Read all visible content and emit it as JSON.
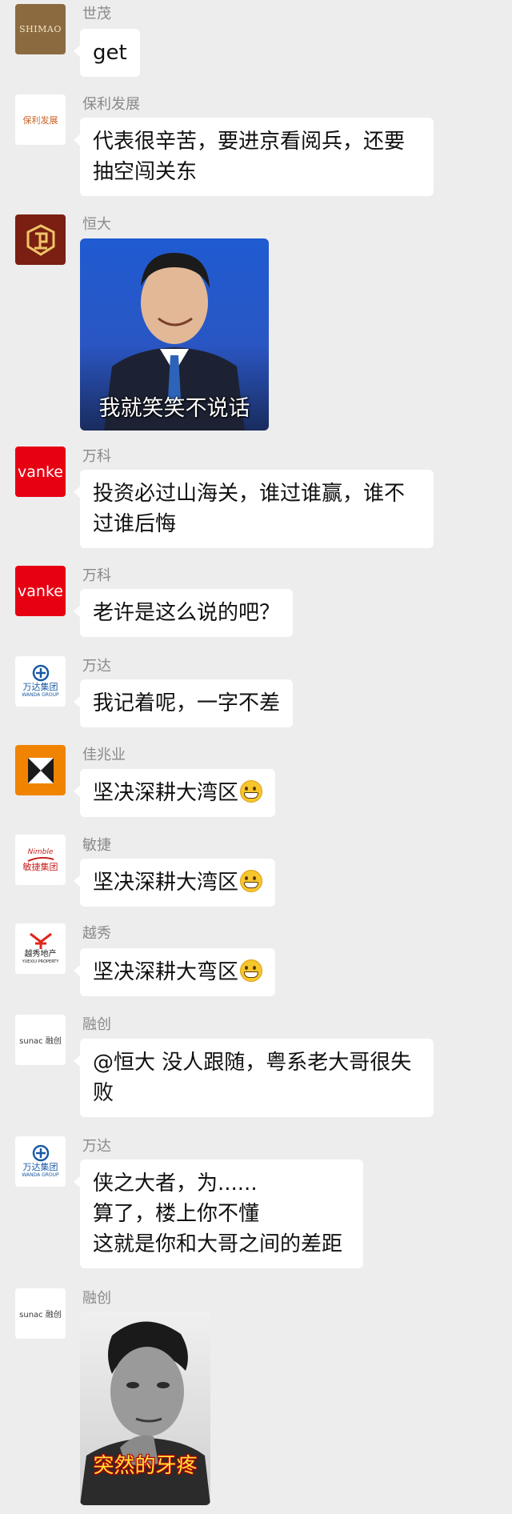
{
  "messages": [
    {
      "sender": "世茂",
      "logo_text": "SHIMAO",
      "text": "get"
    },
    {
      "sender": "保利发展",
      "logo_text": "保利发展",
      "text": "代表很辛苦，要进京看阅兵，还要\n抽空闯关东"
    },
    {
      "sender": "恒大",
      "image_caption": "我就笑笑不说话"
    },
    {
      "sender": "万科",
      "logo_text": "vanke",
      "text": "投资必过山海关，谁过谁赢，谁不\n过谁后悔"
    },
    {
      "sender": "万科",
      "logo_text": "vanke",
      "text": "老许是这么说的吧？"
    },
    {
      "sender": "万达",
      "logo_text": "万达集团",
      "logo_sub": "WANDA GROUP",
      "text": "我记着呢，一字不差"
    },
    {
      "sender": "佳兆业",
      "text": "坚决深耕大湾区"
    },
    {
      "sender": "敏捷",
      "logo_text": "敏捷集团",
      "logo_sub": "Nimble",
      "text": "坚决深耕大湾区"
    },
    {
      "sender": "越秀",
      "logo_text": "越秀地产",
      "logo_sub": "YUEXIU PROPERTY",
      "text": "坚决深耕大弯区"
    },
    {
      "sender": "融创",
      "logo_text": "sunac 融创",
      "text": "@恒大 没人跟随，粤系老大哥很失\n败"
    },
    {
      "sender": "万达",
      "logo_text": "万达集团",
      "logo_sub": "WANDA GROUP",
      "text": "侠之大者，为......\n算了，楼上你不懂\n这就是你和大哥之间的差距"
    },
    {
      "sender": "融创",
      "logo_text": "sunac 融创",
      "image_caption": "突然的牙疼"
    }
  ],
  "emoji": {
    "grin": "grinning-face-emoji"
  },
  "colors": {
    "background": "#ededed",
    "bubble": "#ffffff",
    "sender_name": "#8a8a8a",
    "vanke_red": "#e60012",
    "kaisa_orange": "#f08300",
    "evergrande_brown": "#7a1f12",
    "shimao_brown": "#8c6a3f"
  }
}
